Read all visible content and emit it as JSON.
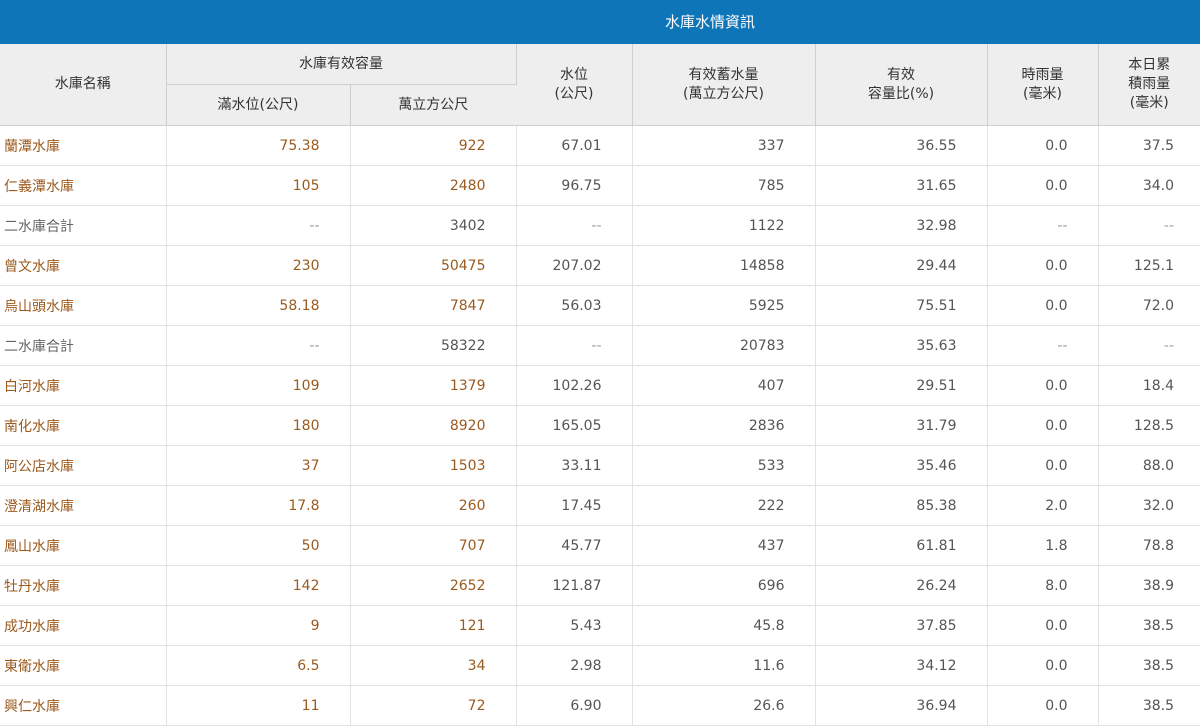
{
  "title": "水庫水情資訊",
  "headers": {
    "name": "水庫名稱",
    "capacity_group": "水庫有效容量",
    "full_level": "滿水位(公尺)",
    "capacity": "萬立方公尺",
    "water_level": "水位\n(公尺)",
    "storage": "有效蓄水量\n(萬立方公尺)",
    "ratio": "有效\n容量比(%)",
    "hourly_rain": "時雨量\n(毫米)",
    "daily_rain": "本日累\n積雨量\n(毫米)"
  },
  "colors": {
    "header_bar": "#0f75b9",
    "link_text": "#9b5a1e",
    "header_bg": "#eeeeee"
  },
  "rows": [
    {
      "name": "蘭潭水庫",
      "link": true,
      "full": "75.38",
      "cap": "922",
      "level": "67.01",
      "storage": "337",
      "ratio": "36.55",
      "hr": "0.0",
      "dr": "37.5"
    },
    {
      "name": "仁義潭水庫",
      "link": true,
      "full": "105",
      "cap": "2480",
      "level": "96.75",
      "storage": "785",
      "ratio": "31.65",
      "hr": "0.0",
      "dr": "34.0"
    },
    {
      "name": "二水庫合計",
      "link": false,
      "full": "--",
      "cap": "3402",
      "level": "--",
      "storage": "1122",
      "ratio": "32.98",
      "hr": "--",
      "dr": "--"
    },
    {
      "name": "曾文水庫",
      "link": true,
      "full": "230",
      "cap": "50475",
      "level": "207.02",
      "storage": "14858",
      "ratio": "29.44",
      "hr": "0.0",
      "dr": "125.1"
    },
    {
      "name": "烏山頭水庫",
      "link": true,
      "full": "58.18",
      "cap": "7847",
      "level": "56.03",
      "storage": "5925",
      "ratio": "75.51",
      "hr": "0.0",
      "dr": "72.0"
    },
    {
      "name": "二水庫合計",
      "link": false,
      "full": "--",
      "cap": "58322",
      "level": "--",
      "storage": "20783",
      "ratio": "35.63",
      "hr": "--",
      "dr": "--"
    },
    {
      "name": "白河水庫",
      "link": true,
      "full": "109",
      "cap": "1379",
      "level": "102.26",
      "storage": "407",
      "ratio": "29.51",
      "hr": "0.0",
      "dr": "18.4"
    },
    {
      "name": "南化水庫",
      "link": true,
      "full": "180",
      "cap": "8920",
      "level": "165.05",
      "storage": "2836",
      "ratio": "31.79",
      "hr": "0.0",
      "dr": "128.5"
    },
    {
      "name": "阿公店水庫",
      "link": true,
      "full": "37",
      "cap": "1503",
      "level": "33.11",
      "storage": "533",
      "ratio": "35.46",
      "hr": "0.0",
      "dr": "88.0"
    },
    {
      "name": "澄清湖水庫",
      "link": true,
      "full": "17.8",
      "cap": "260",
      "level": "17.45",
      "storage": "222",
      "ratio": "85.38",
      "hr": "2.0",
      "dr": "32.0"
    },
    {
      "name": "鳳山水庫",
      "link": true,
      "full": "50",
      "cap": "707",
      "level": "45.77",
      "storage": "437",
      "ratio": "61.81",
      "hr": "1.8",
      "dr": "78.8"
    },
    {
      "name": "牡丹水庫",
      "link": true,
      "full": "142",
      "cap": "2652",
      "level": "121.87",
      "storage": "696",
      "ratio": "26.24",
      "hr": "8.0",
      "dr": "38.9"
    },
    {
      "name": "成功水庫",
      "link": true,
      "full": "9",
      "cap": "121",
      "level": "5.43",
      "storage": "45.8",
      "ratio": "37.85",
      "hr": "0.0",
      "dr": "38.5"
    },
    {
      "name": "東衛水庫",
      "link": true,
      "full": "6.5",
      "cap": "34",
      "level": "2.98",
      "storage": "11.6",
      "ratio": "34.12",
      "hr": "0.0",
      "dr": "38.5"
    },
    {
      "name": "興仁水庫",
      "link": true,
      "full": "11",
      "cap": "72",
      "level": "6.90",
      "storage": "26.6",
      "ratio": "36.94",
      "hr": "0.0",
      "dr": "38.5"
    }
  ]
}
